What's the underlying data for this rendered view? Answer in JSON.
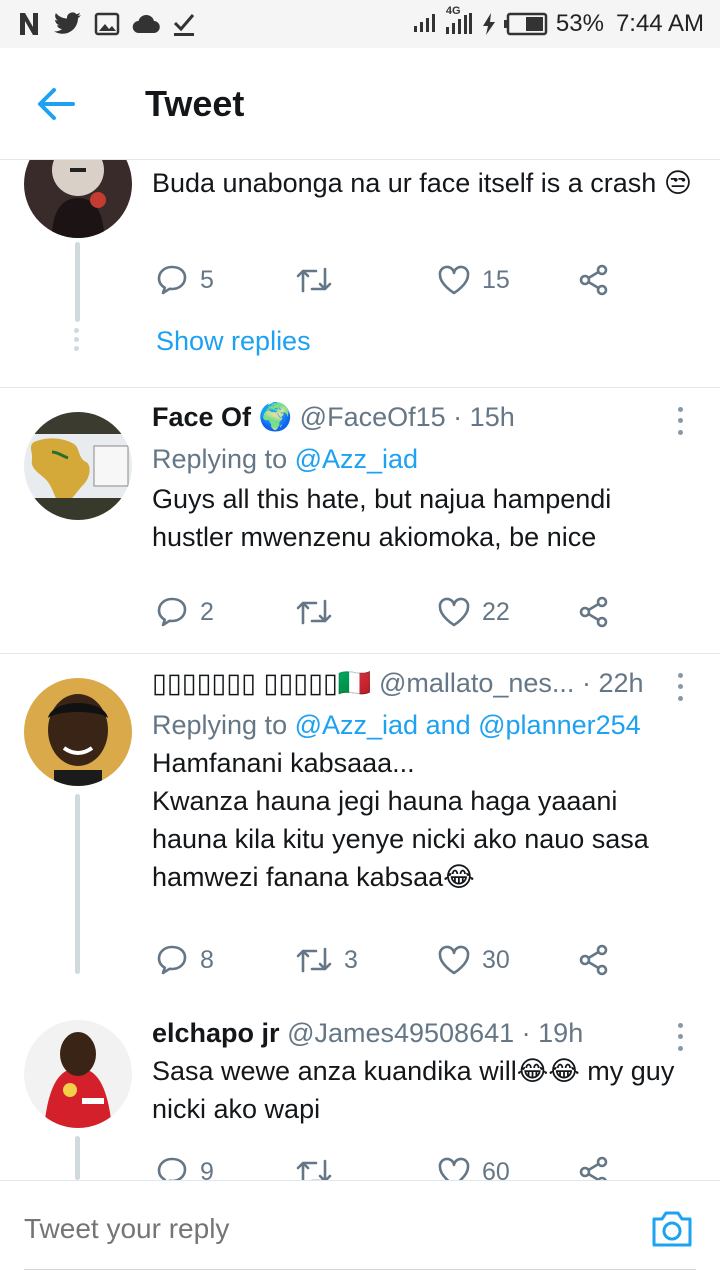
{
  "status_bar": {
    "battery": "53%",
    "time": "7:44 AM",
    "network": "4G",
    "left_icons": [
      "netflix-icon",
      "twitter-icon",
      "gallery-icon",
      "cloud-icon",
      "download-done-icon"
    ],
    "right_icons": [
      "vibrate-icon",
      "signal-icon",
      "charging-icon",
      "battery-icon"
    ]
  },
  "header": {
    "title": "Tweet",
    "back_icon": "arrow-left-icon"
  },
  "colors": {
    "accent": "#1da1f2",
    "muted": "#657786",
    "text": "#14171a"
  },
  "tweets": [
    {
      "text": "Buda unabonga na ur face itself is a crash 😒",
      "replies": "5",
      "retweets": "",
      "likes": "15",
      "show_replies": "Show replies"
    },
    {
      "name": "Face Of 🌍",
      "handle": "@FaceOf15",
      "sep": "·",
      "time": "15h",
      "replying_prefix": "Replying to",
      "replying_to": "@Azz_iad",
      "text": "Guys all this hate, but najua hampendi hustler mwenzenu akiomoka, be nice",
      "replies": "2",
      "retweets": "",
      "likes": "22"
    },
    {
      "name": "▯▯▯▯▯▯▯ ▯▯▯▯▯🇮🇹",
      "handle": "@mallato_nes...",
      "sep": "·",
      "time": "22h",
      "replying_prefix": "Replying to",
      "replying_to": "@Azz_iad and @planner254",
      "text": "Hamfanani kabsaaa...\nKwanza hauna jegi hauna haga yaaani hauna kila kitu yenye nicki ako nauo sasa hamwezi fanana kabsaa😂",
      "replies": "8",
      "retweets": "3",
      "likes": "30"
    },
    {
      "name": "elchapo jr",
      "handle": "@James49508641",
      "sep": "·",
      "time": "19h",
      "text": "Sasa wewe anza kuandika will😂😂 my guy nicki ako wapi",
      "replies": "9",
      "retweets": "",
      "likes": "60"
    }
  ],
  "reply_bar": {
    "placeholder": "Tweet your reply",
    "camera_icon": "camera-icon"
  }
}
